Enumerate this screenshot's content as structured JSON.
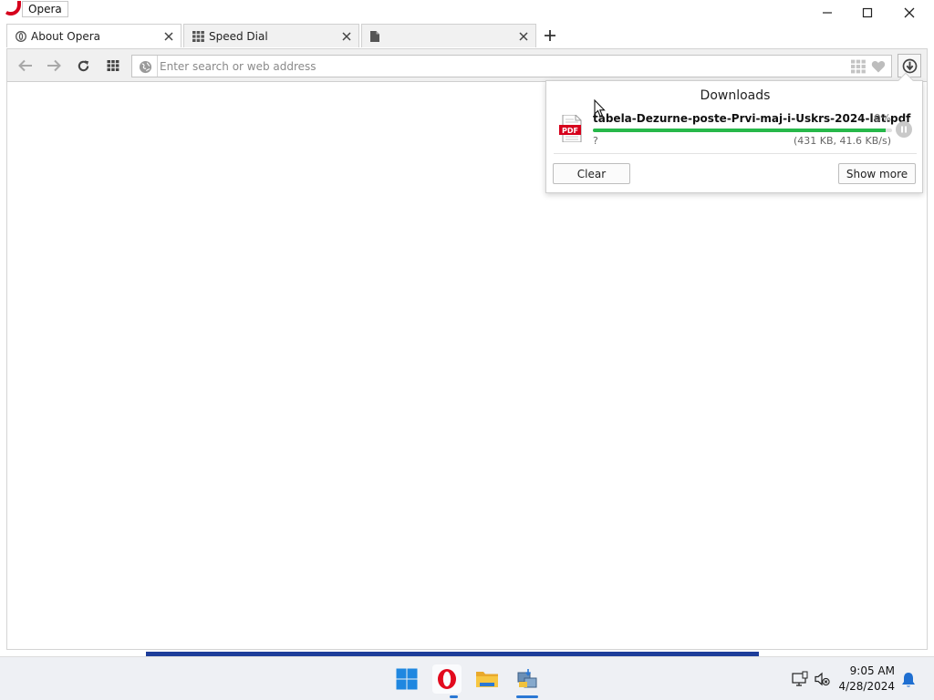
{
  "window": {
    "title": "Opera"
  },
  "tabs": [
    {
      "label": "About Opera",
      "icon": "opera-icon"
    },
    {
      "label": "Speed Dial",
      "icon": "speed-dial-icon"
    },
    {
      "label": "",
      "icon": "page-icon"
    }
  ],
  "address_bar": {
    "placeholder": "Enter search or web address",
    "value": ""
  },
  "downloads": {
    "title": "Downloads",
    "item": {
      "filename": "tabela-Dezurne-poste-Prvi-maj-i-Uskrs-2024-lat.pdf",
      "percent": "0%",
      "progress": 0.98,
      "status": "?",
      "size_speed": "(431 KB, 41.6 KB/s)",
      "file_icon_label": "PDF"
    },
    "clear_label": "Clear",
    "show_more_label": "Show more"
  },
  "taskbar": {
    "apps": [
      "windows-start-icon",
      "opera-icon",
      "file-explorer-icon",
      "network-transfer-icon"
    ],
    "time": "9:05 AM",
    "date": "4/28/2024"
  },
  "colors": {
    "progress": "#27b84a",
    "opera_red": "#d6001c",
    "accent": "#2b78d4"
  }
}
